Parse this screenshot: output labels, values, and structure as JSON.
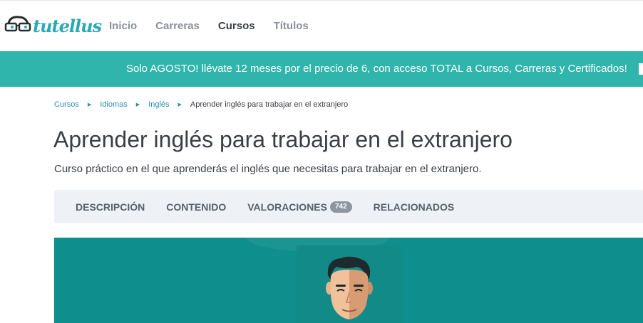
{
  "brand": {
    "name": "tutellus",
    "color": "#2aa9b2"
  },
  "nav": {
    "items": [
      {
        "label": "Inicio",
        "active": false
      },
      {
        "label": "Carreras",
        "active": false
      },
      {
        "label": "Cursos",
        "active": true
      },
      {
        "label": "Títulos",
        "active": false
      }
    ]
  },
  "promo": {
    "text": "Solo AGOSTO! llévate 12 meses por el precio de 6, con acceso TOTAL a Cursos, Carreras y Certificados!",
    "bg_color": "#2fb5ac"
  },
  "breadcrumb": {
    "items": [
      "Cursos",
      "Idiomas",
      "Inglés"
    ],
    "current": "Aprender inglés para trabajar en el extranjero"
  },
  "course": {
    "title": "Aprender inglés para trabajar en el extranjero",
    "subtitle": "Curso práctico en el que aprenderás el inglés que necesitas para trabajar en el extranjero."
  },
  "tabs": {
    "descripcion": "DESCRIPCIÓN",
    "contenido": "CONTENIDO",
    "valoraciones": "VALORACIONES",
    "valoraciones_count": "742",
    "relacionados": "RELACIONADOS"
  },
  "hero": {
    "bg_color": "#0e8e8c",
    "image": "illustrated-man-avatar"
  }
}
